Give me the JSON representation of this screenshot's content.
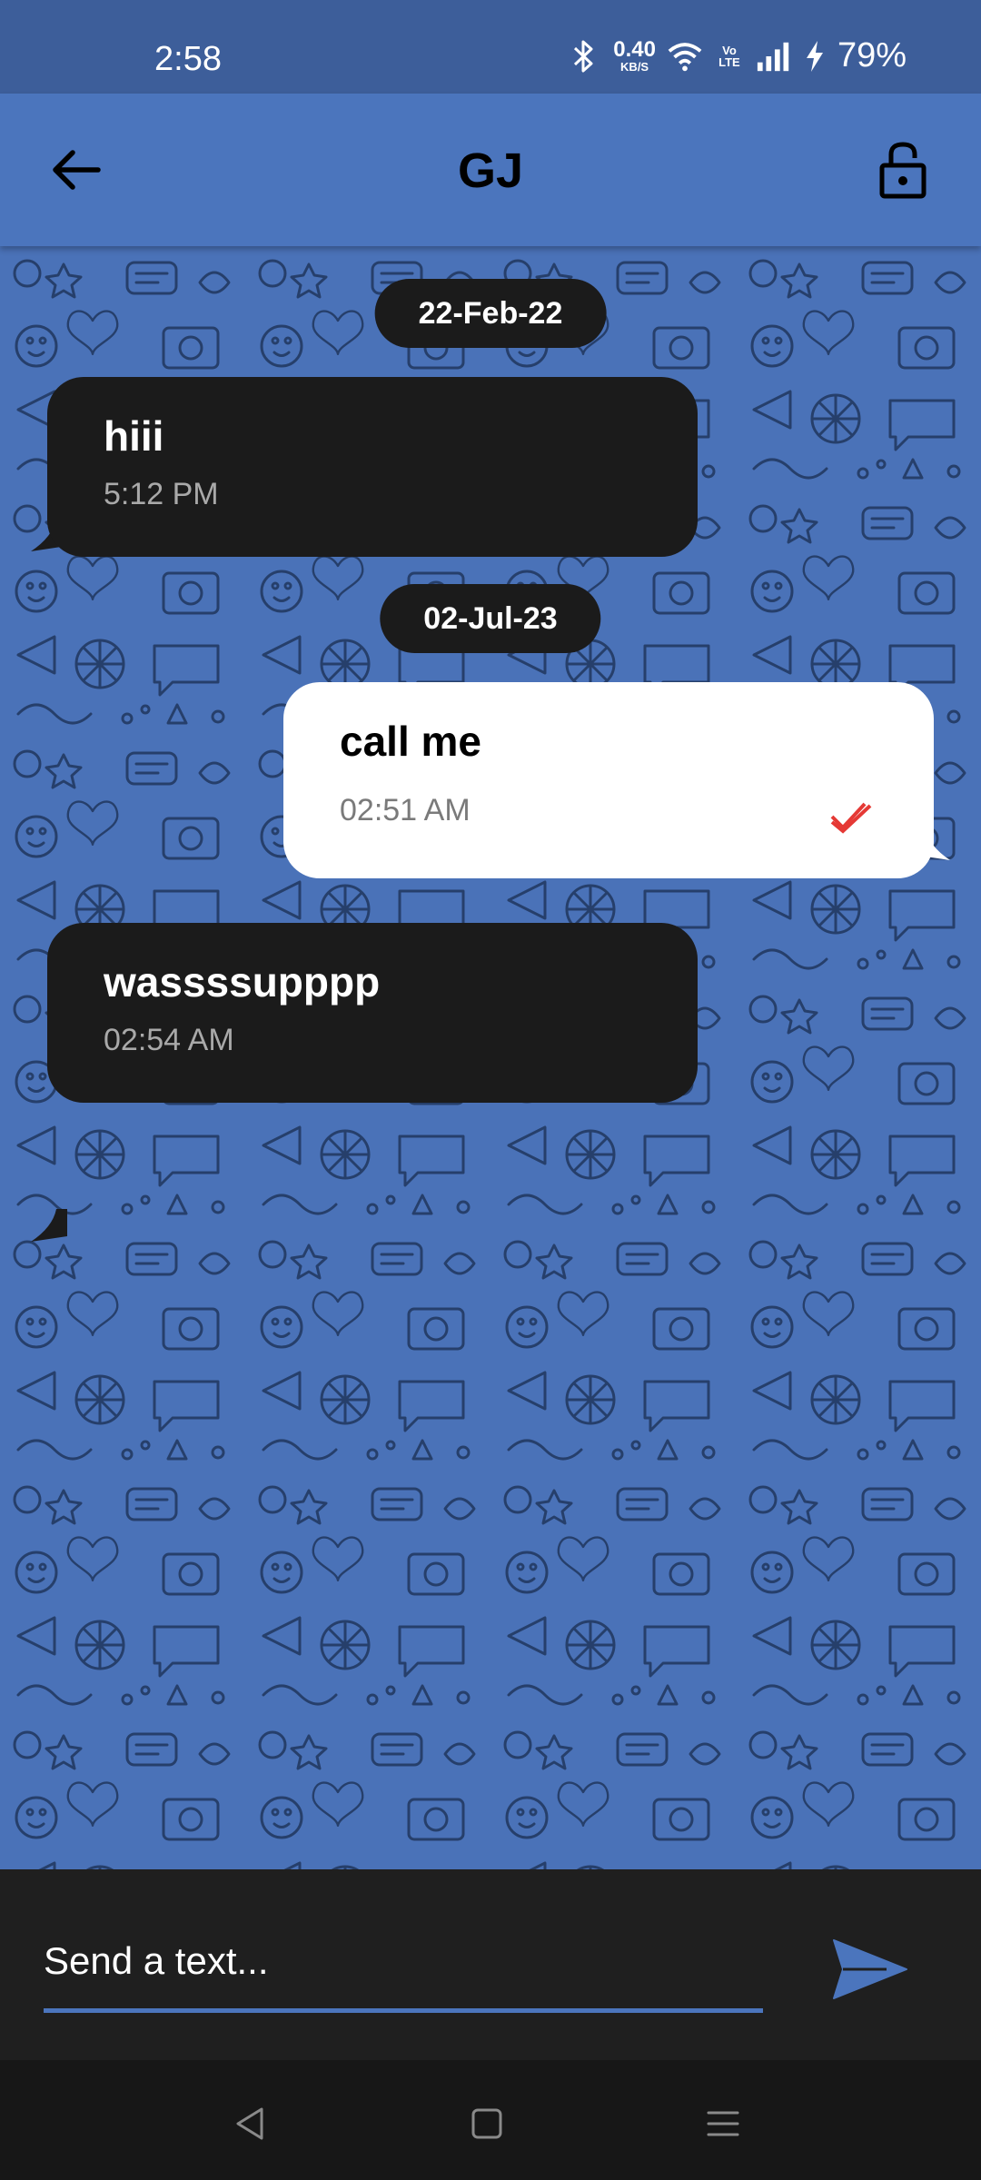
{
  "status_bar": {
    "time": "2:58",
    "net_speed_value": "0.40",
    "net_speed_unit": "KB/S",
    "volte_label": "Vo LTE",
    "battery": "79%",
    "icons": [
      "bluetooth-icon",
      "wifi-icon",
      "signal-icon",
      "charging-icon"
    ]
  },
  "header": {
    "title": "GJ",
    "back_icon": "arrow-left-icon",
    "lock_icon": "unlock-icon",
    "background": "#4b75bd"
  },
  "chat": {
    "background_color": "#4a72b8",
    "items": [
      {
        "type": "date",
        "label": "22-Feb-22"
      },
      {
        "type": "message",
        "direction": "incoming",
        "text": "hiii",
        "time": "5:12 PM"
      },
      {
        "type": "date",
        "label": "02-Jul-23"
      },
      {
        "type": "message",
        "direction": "outgoing",
        "text": "call me",
        "time": "02:51 AM",
        "status_icon": "double-check-icon",
        "status_color": "#e53935"
      },
      {
        "type": "message",
        "direction": "incoming",
        "text": "wassssupppp",
        "time": "02:54 AM"
      }
    ]
  },
  "composer": {
    "placeholder": "Send a text...",
    "send_icon": "send-icon",
    "accent": "#4b75bd"
  },
  "nav_bar": {
    "buttons": [
      "back-triangle-icon",
      "home-square-icon",
      "recents-menu-icon"
    ]
  }
}
